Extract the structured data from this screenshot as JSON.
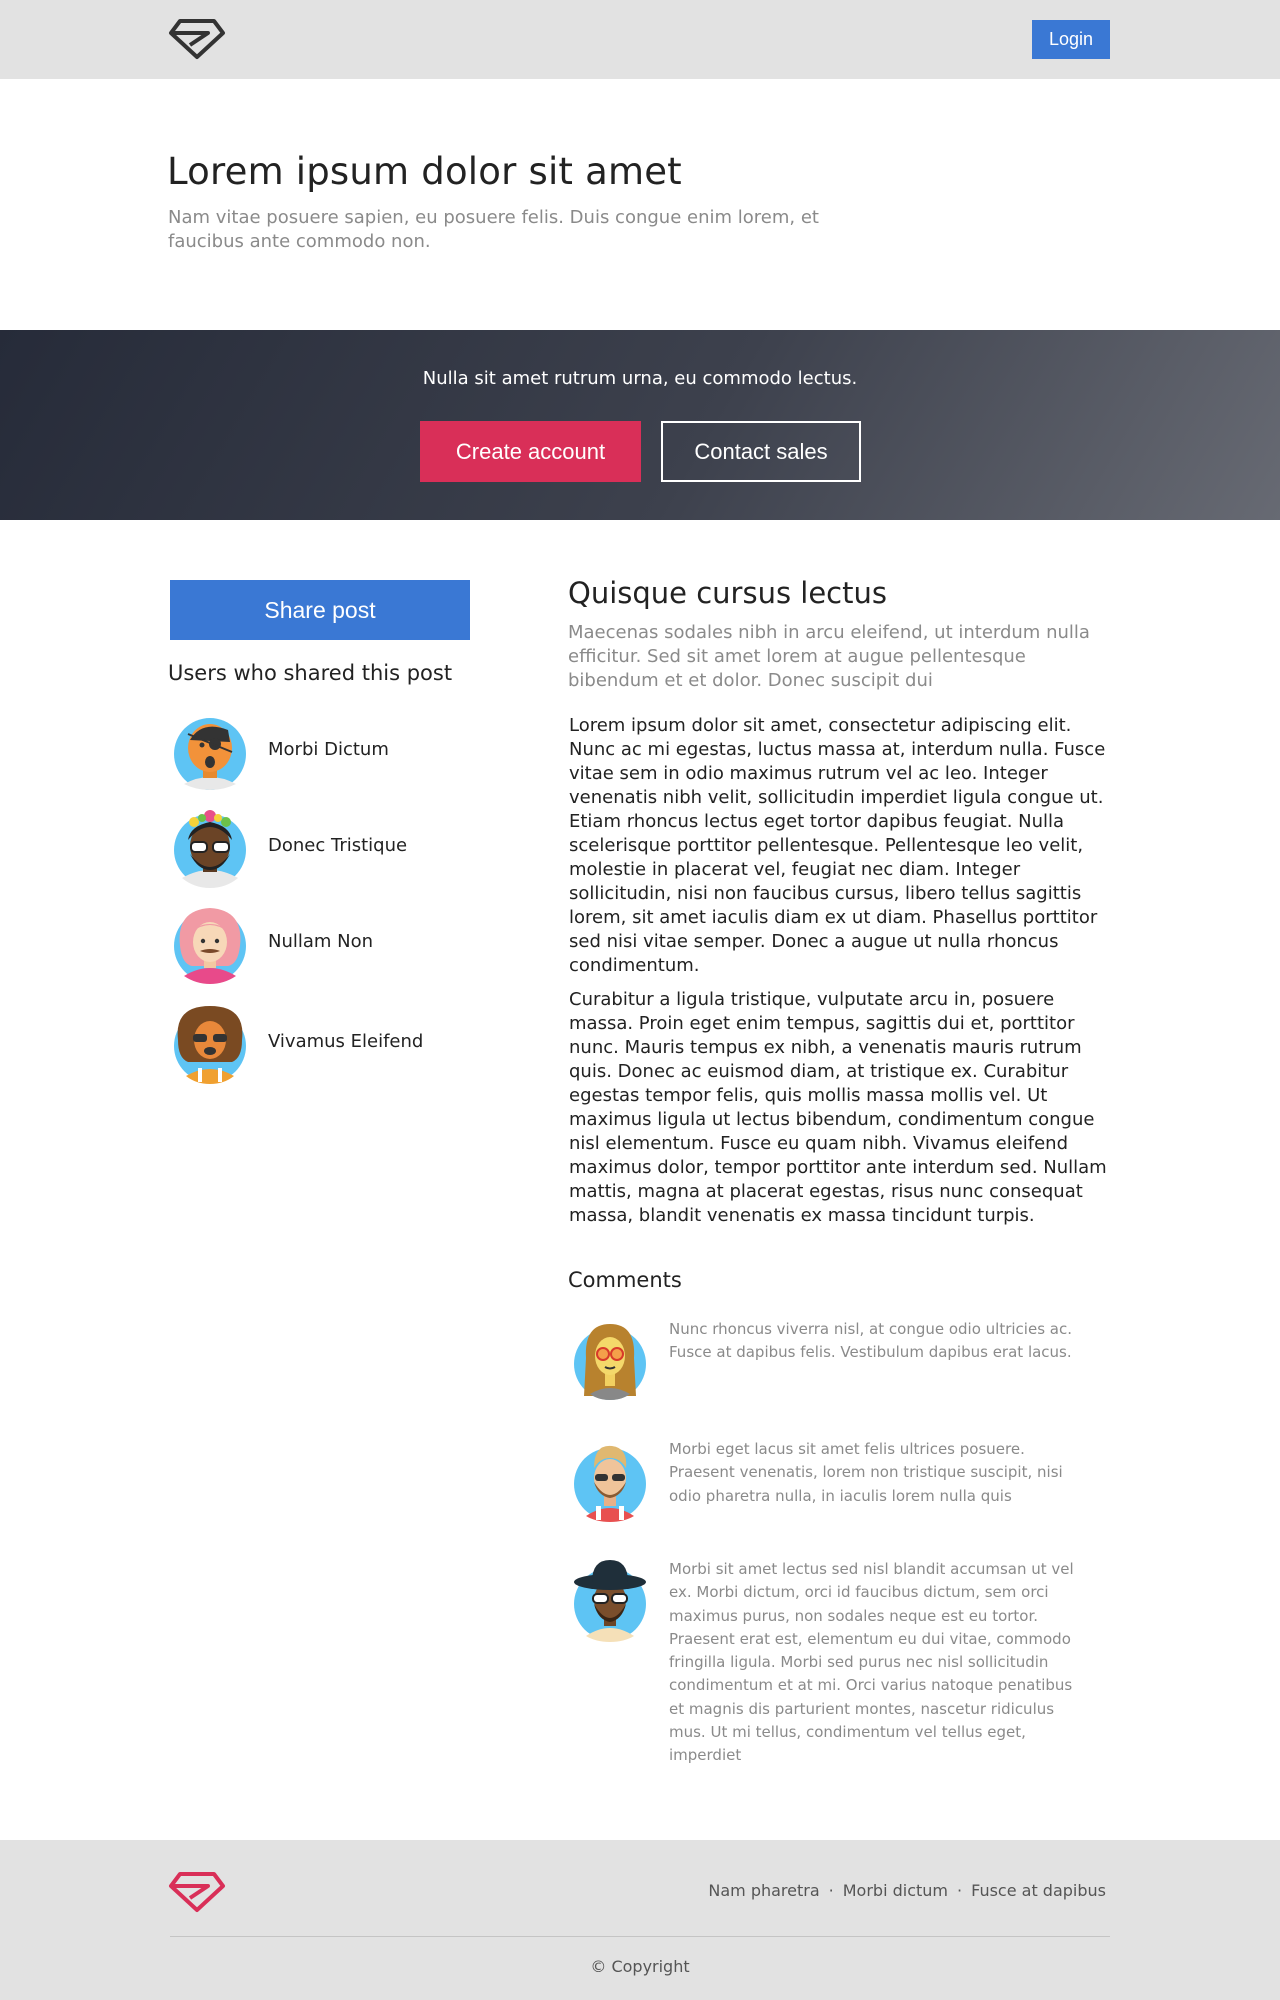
{
  "nav": {
    "logo_icon": "diamond-logo-icon",
    "login_label": "Login"
  },
  "hero": {
    "title": "Lorem ipsum dolor sit amet",
    "subtitle": "Nam vitae posuere sapien, eu posuere felis. Duis congue enim lorem, et faucibus ante commodo non."
  },
  "cta": {
    "text": "Nulla sit amet rutrum urna, eu commodo lectus.",
    "create_label": "Create account",
    "contact_label": "Contact sales"
  },
  "sidebar": {
    "share_label": "Share post",
    "heading": "Users who shared this post",
    "users": [
      {
        "name": "Morbi Dictum",
        "icon": "pirate-avatar-icon"
      },
      {
        "name": "Donec Tristique",
        "icon": "flower-crown-avatar-icon"
      },
      {
        "name": "Nullam Non",
        "icon": "pink-hair-avatar-icon"
      },
      {
        "name": "Vivamus Eleifend",
        "icon": "curly-hair-avatar-icon"
      }
    ]
  },
  "post": {
    "title": "Quisque cursus lectus",
    "lead": "Maecenas sodales nibh in arcu eleifend, ut interdum nulla efficitur. Sed sit amet lorem at augue pellentesque bibendum et et dolor. Donec suscipit dui",
    "paragraphs": [
      "Lorem ipsum dolor sit amet, consectetur adipiscing elit. Nunc ac mi egestas, luctus massa at, interdum nulla. Fusce vitae sem in odio maximus rutrum vel ac leo. Integer venenatis nibh velit, sollicitudin imperdiet ligula congue ut. Etiam rhoncus lectus eget tortor dapibus feugiat. Nulla scelerisque porttitor pellentesque. Pellentesque leo velit, molestie in placerat vel, feugiat nec diam. Integer sollicitudin, nisi non faucibus cursus, libero tellus sagittis lorem, sit amet iaculis diam ex ut diam. Phasellus porttitor sed nisi vitae semper. Donec a augue ut nulla rhoncus condimentum.",
      "Curabitur a ligula tristique, vulputate arcu in, posuere massa. Proin eget enim tempus, sagittis dui et, porttitor nunc. Mauris tempus ex nibh, a venenatis mauris rutrum quis. Donec ac euismod diam, at tristique ex. Curabitur egestas tempor felis, quis mollis massa mollis vel. Ut maximus ligula ut lectus bibendum, condimentum congue nisl elementum. Fusce eu quam nibh. Vivamus eleifend maximus dolor, tempor porttitor ante interdum sed. Nullam mattis, magna at placerat egestas, risus nunc consequat massa, blandit venenatis ex massa tincidunt turpis."
    ]
  },
  "comments": {
    "heading": "Comments",
    "items": [
      {
        "icon": "long-hair-glasses-avatar-icon",
        "text": "Nunc rhoncus viverra nisl, at congue odio ultricies ac. Fusce at dapibus felis. Vestibulum dapibus erat lacus."
      },
      {
        "icon": "blond-beard-avatar-icon",
        "text": "Morbi eget lacus sit amet felis ultrices posuere. Praesent venenatis, lorem non tristique suscipit, nisi odio pharetra nulla, in iaculis lorem nulla quis"
      },
      {
        "icon": "hat-beard-avatar-icon",
        "text": "Morbi sit amet lectus sed nisl blandit accumsan ut vel ex. Morbi dictum, orci id faucibus dictum, sem orci maximus purus, non sodales neque est eu tortor. Praesent erat est, elementum eu dui vitae, commodo fringilla ligula. Morbi sed purus nec nisl sollicitudin condimentum et at mi. Orci varius natoque penatibus et magnis dis parturient montes, nascetur ridiculus mus. Ut mi tellus, condimentum vel tellus eget, imperdiet"
      }
    ]
  },
  "footer": {
    "logo_icon": "diamond-logo-icon",
    "links": [
      "Nam pharetra",
      "Morbi dictum",
      "Fusce at dapibus"
    ],
    "separator": "·",
    "copyright": "© Copyright"
  },
  "colors": {
    "primary": "#3a78d4",
    "accent": "#d92f58",
    "nav_bg": "#e2e2e2",
    "muted_text": "#8a8a8a"
  }
}
